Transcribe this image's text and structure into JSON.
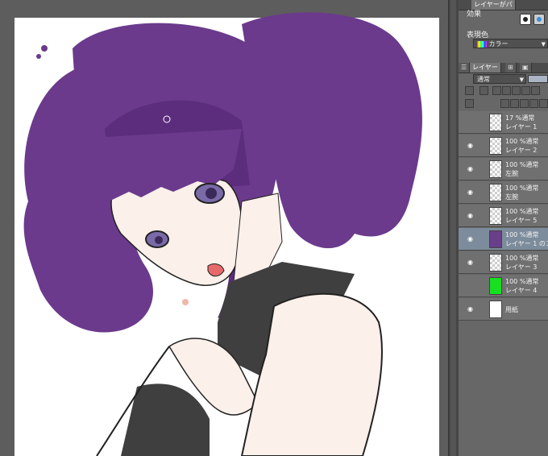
{
  "panel": {
    "top_tabs": [
      "レイヤーがパ"
    ],
    "effect_label": "効果",
    "display_color_label": "表現色",
    "display_color_value": "カラー",
    "layer_tabs": [
      "レイヤー"
    ],
    "blend_mode_value": "通常",
    "layers": [
      {
        "opacity_mode": "17 %通常",
        "name": "レイヤー 1",
        "visible": false,
        "thumb": "transparent"
      },
      {
        "opacity_mode": "100 %通常",
        "name": "レイヤー 2",
        "visible": true,
        "thumb": "transparent"
      },
      {
        "opacity_mode": "100 %通常",
        "name": "左腕",
        "visible": true,
        "thumb": "transparent"
      },
      {
        "opacity_mode": "100 %通常",
        "name": "左腕",
        "visible": true,
        "thumb": "transparent"
      },
      {
        "opacity_mode": "100 %通常",
        "name": "レイヤー 5",
        "visible": true,
        "thumb": "transparent"
      },
      {
        "opacity_mode": "100 %通常",
        "name": "レイヤー 1 のコピ",
        "visible": true,
        "thumb": "purple",
        "selected": true
      },
      {
        "opacity_mode": "100 %通常",
        "name": "レイヤー 3",
        "visible": true,
        "thumb": "transparent"
      },
      {
        "opacity_mode": "100 %通常",
        "name": "レイヤー 4",
        "visible": false,
        "thumb": "green"
      },
      {
        "opacity_mode": "",
        "name": "用紙",
        "visible": true,
        "thumb": "white"
      }
    ]
  },
  "colors": {
    "hair": "#6b3a8c",
    "hair_shadow": "#4f2470",
    "skin": "#fbf0ea",
    "clothing": "#3f3f3f",
    "eye": "#7a6aa8",
    "paper_layer": "#18e020"
  }
}
